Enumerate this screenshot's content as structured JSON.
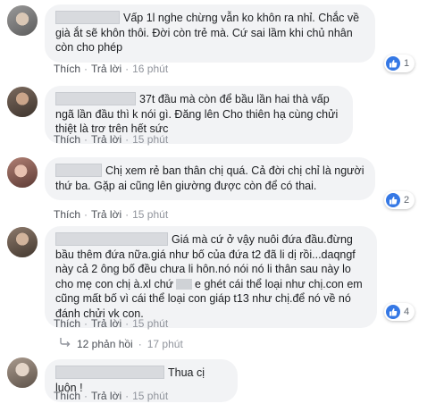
{
  "comments": [
    {
      "text": "Vấp 1l nghe chừng vẫn ko khôn ra nhỉ. Chắc về già ắt sẽ khôn thôi. Đời còn trẻ mà. Cứ sai lầm khi chủ nhân còn cho phép",
      "like_label": "Thích",
      "reply_label": "Trả lời",
      "time": "16 phút",
      "reactions": "1"
    },
    {
      "text": "37t đầu mà còn để bầu lần hai thà vấp ngã lần đầu thì k nói gì. Đăng lên Cho thiên hạ cùng chửi thiệt là trơ trên hết sức",
      "like_label": "Thích",
      "reply_label": "Trả lời",
      "time": "15 phút"
    },
    {
      "text": "Chị xem rẻ ban thân chị quá. Cả đời chị chỉ là người thứ ba. Gặp ai cũng lên giường được còn để có thai.",
      "like_label": "Thích",
      "reply_label": "Trả lời",
      "time": "15 phút",
      "reactions": "2"
    },
    {
      "text_a": "Giá mà cứ ở vậy nuôi đứa đầu.đừng bầu thêm đứa nữa.giá như bố của đứa t2 đã li dị rồi...daqngf này cả 2 ông bố đều chưa li hôn.nó nói nó li thân sau này lo cho mẹ con chị à.xl chứ",
      "text_b": "e ghét cái thể loại như chị.con em cũng mất bố vì cái thể loại con giáp t13 như chị.để nó về nó đánh chửi vk con.",
      "like_label": "Thích",
      "reply_label": "Trả lời",
      "time": "15 phút",
      "reactions": "4",
      "replies_label": "12 phản hồi",
      "replies_time": "17 phút"
    },
    {
      "text": "Thua cị luôn !",
      "like_label": "Thích",
      "reply_label": "Trả lời",
      "time": "15 phút"
    }
  ],
  "colors": {
    "bubble": "#f2f3f5",
    "like_blue": "#3578e5",
    "meta_gray": "#90949c"
  }
}
